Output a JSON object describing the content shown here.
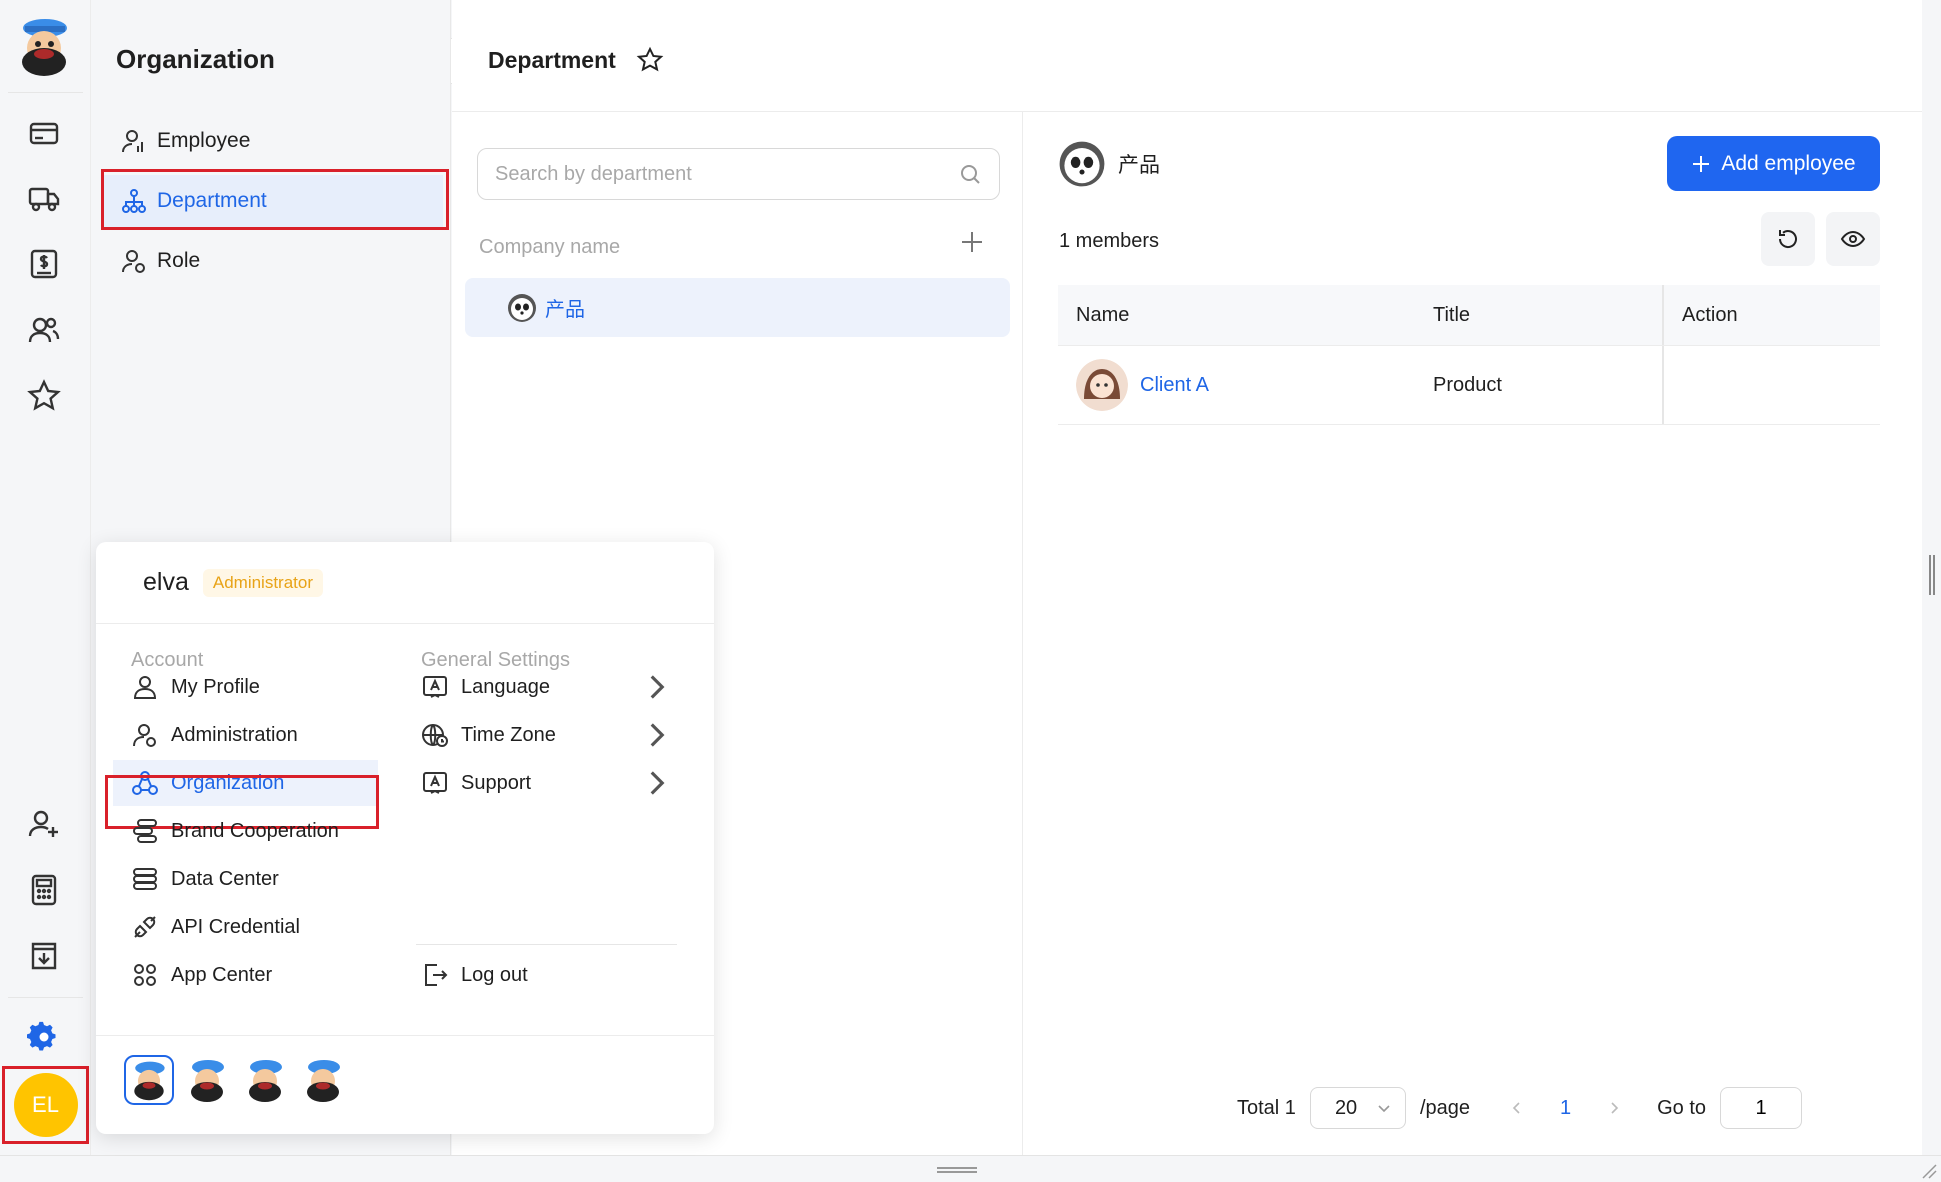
{
  "subnav": {
    "title": "Organization",
    "items": [
      {
        "label": "Employee"
      },
      {
        "label": "Department"
      },
      {
        "label": "Role"
      }
    ]
  },
  "header": {
    "title": "Department"
  },
  "dept_panel": {
    "search_placeholder": "Search by department",
    "company_label": "Company name",
    "tree": [
      {
        "label": "产品"
      }
    ]
  },
  "detail": {
    "dept_name": "产品",
    "add_button": "Add employee",
    "members_count": "1 members",
    "table": {
      "headers": [
        "Name",
        "Title",
        "Action"
      ],
      "rows": [
        {
          "name": "Client A",
          "title": "Product",
          "action": ""
        }
      ]
    },
    "pagination": {
      "total": "Total 1",
      "page_size": "20",
      "per_page": "/page",
      "current_page": "1",
      "goto_label": "Go to",
      "goto_value": "1"
    }
  },
  "user_menu": {
    "username": "elva",
    "role": "Administrator",
    "account_label": "Account",
    "account_items": [
      {
        "label": "My Profile"
      },
      {
        "label": "Administration"
      },
      {
        "label": "Organization"
      },
      {
        "label": "Brand Cooperation"
      },
      {
        "label": "Data Center"
      },
      {
        "label": "API Credential"
      },
      {
        "label": "App Center"
      }
    ],
    "settings_label": "General Settings",
    "settings_items": [
      {
        "label": "Language"
      },
      {
        "label": "Time Zone"
      },
      {
        "label": "Support"
      }
    ],
    "logout": "Log out"
  },
  "avatar_initials": "EL",
  "colors": {
    "accent": "#1f66f0",
    "highlight": "#d9202a",
    "avatar": "#ffc400"
  }
}
